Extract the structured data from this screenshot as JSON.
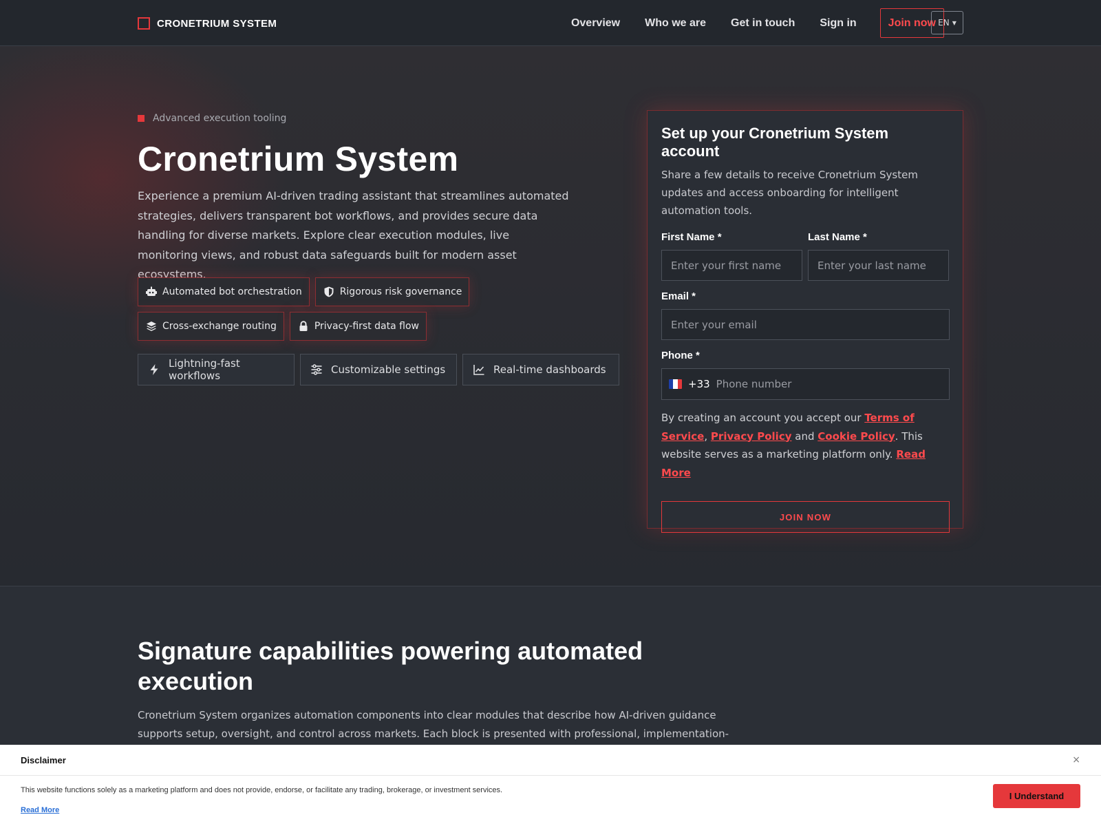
{
  "header": {
    "brand": "CRONETRIUM SYSTEM",
    "nav": [
      "Overview",
      "Who we are",
      "Get in touch",
      "Sign in"
    ],
    "join_label": "Join now",
    "language": "EN"
  },
  "hero": {
    "eyebrow": "Advanced execution tooling",
    "title": "Cronetrium System",
    "lead": "Experience a premium AI-driven trading assistant that streamlines automated strategies, delivers transparent bot workflows, and provides secure data handling for diverse markets. Explore clear execution modules, live monitoring views, and robust data safeguards built for modern asset ecosystems.",
    "tags": [
      {
        "label": "Automated bot orchestration",
        "icon": "robot-icon"
      },
      {
        "label": "Rigorous risk governance",
        "icon": "shield-icon"
      },
      {
        "label": "Cross-exchange routing",
        "icon": "layers-icon"
      },
      {
        "label": "Privacy-first data flow",
        "icon": "lock-icon"
      }
    ],
    "features": [
      {
        "label": "Lightning-fast workflows",
        "icon": "bolt-icon"
      },
      {
        "label": "Customizable settings",
        "icon": "sliders-icon"
      },
      {
        "label": "Real-time dashboards",
        "icon": "chart-line-icon"
      }
    ]
  },
  "form": {
    "title": "Set up your Cronetrium System account",
    "subtitle": "Share a few details to receive Cronetrium System updates and access onboarding for intelligent automation tools.",
    "first_name": {
      "label": "First Name *",
      "placeholder": "Enter your first name",
      "value": ""
    },
    "last_name": {
      "label": "Last Name *",
      "placeholder": "Enter your last name",
      "value": ""
    },
    "email": {
      "label": "Email *",
      "placeholder": "Enter your email",
      "value": ""
    },
    "phone": {
      "label": "Phone *",
      "dial_code": "+33",
      "placeholder": "Phone number",
      "value": ""
    },
    "terms": {
      "prefix": "By creating an account you accept our ",
      "tos": "Terms of Service",
      "comma": ",",
      "privacy": "Privacy Policy",
      "and": " and ",
      "cookie": "Cookie Policy",
      "suffix": ". This website serves as a marketing platform only. ",
      "read_more": "Read More"
    },
    "submit_label": "JOIN NOW"
  },
  "capabilities": {
    "title": "Signature capabilities powering automated execution",
    "lead": "Cronetrium System organizes automation components into clear modules that describe how AI-driven guidance supports setup, oversight, and control across markets. Each block is presented with professional, implementation-focused language"
  },
  "disclaimer": {
    "title": "Disclaimer",
    "close": "×",
    "text": "This website functions solely as a marketing platform and does not provide, endorse, or facilitate any trading, brokerage, or investment services.",
    "read_more": "Read More",
    "button": "I Understand"
  },
  "colors": {
    "accent": "#e5383b",
    "background": "#2b2f36",
    "header": "#23272d",
    "link": "#2a6fd6"
  }
}
